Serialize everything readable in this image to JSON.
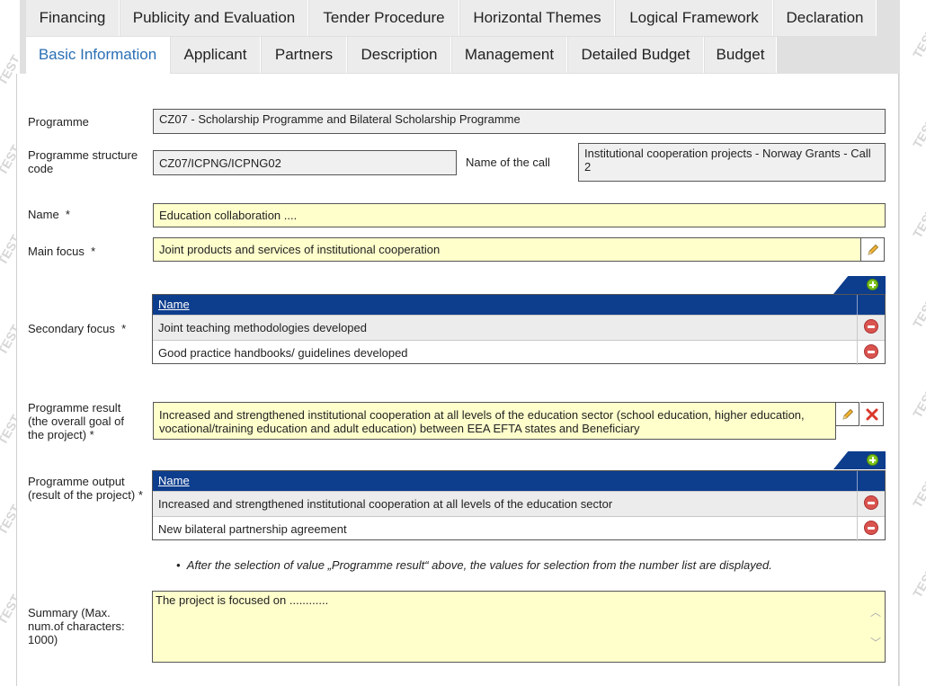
{
  "watermark": "TEST",
  "tabs_row1": [
    "Financing",
    "Publicity and Evaluation",
    "Tender Procedure",
    "Horizontal Themes",
    "Logical Framework",
    "Declaration"
  ],
  "tabs_row2": [
    "Basic Information",
    "Applicant",
    "Partners",
    "Description",
    "Management",
    "Detailed Budget",
    "Budget"
  ],
  "form": {
    "programme_label": "Programme",
    "programme_value": "CZ07 - Scholarship Programme and Bilateral Scholarship Programme",
    "structure_label": "Programme structure code",
    "structure_value": "CZ07/ICPNG/ICPNG02",
    "call_label": "Name of the call",
    "call_value": "Institutional cooperation projects - Norway Grants - Call 2",
    "name_label": "Name",
    "name_value": "Education collaboration ....",
    "main_focus_label": "Main focus",
    "main_focus_value": "Joint products and services of institutional cooperation",
    "secondary_label": "Secondary focus",
    "secondary_header": "Name",
    "secondary_rows": [
      "Joint teaching methodologies developed",
      "Good practice handbooks/ guidelines developed"
    ],
    "result_label": "Programme result (the overall goal of the project) *",
    "result_value": "Increased and strengthened institutional cooperation at all levels of the education sector (school education, higher education, vocational/training education and adult education) between EEA EFTA states and Beneficiary",
    "output_label": "Programme output (result of the project) *",
    "output_header": "Name",
    "output_rows": [
      "Increased and strengthened institutional cooperation at all levels of the education sector",
      "New bilateral partnership agreement"
    ],
    "note": "After the selection of value „Programme result“ above, the values for selection from the number list are displayed.",
    "summary_label": "Summary (Max. num.of characters: 1000)",
    "summary_value": "The project is focused on ............",
    "required_mark": "*"
  },
  "colors": {
    "accent": "#2a6fb5",
    "table_header": "#0d3d8d",
    "field_yellow": "#ffffcc",
    "delete_red": "#d9534f",
    "add_green": "#7ec31f"
  }
}
